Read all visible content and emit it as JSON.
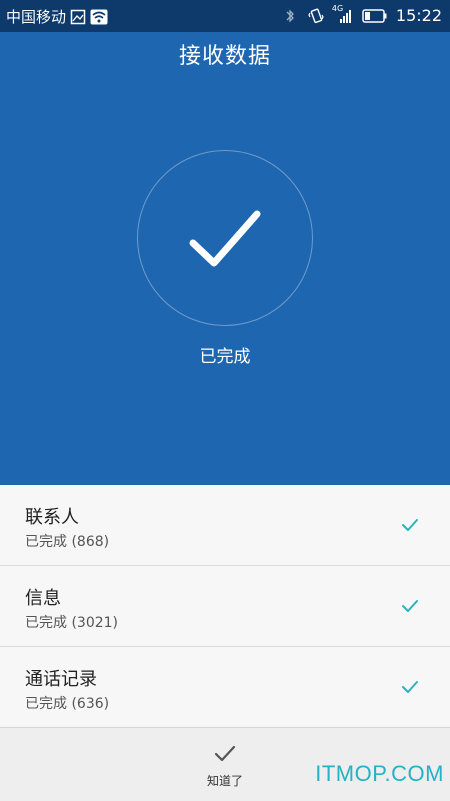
{
  "statusbar": {
    "carrier": "中国移动",
    "network": "4G",
    "time": "15:22"
  },
  "header": {
    "title": "接收数据"
  },
  "progress": {
    "status": "已完成"
  },
  "items": [
    {
      "name": "联系人",
      "status": "已完成 (868)"
    },
    {
      "name": "信息",
      "status": "已完成 (3021)"
    },
    {
      "name": "通话记录",
      "status": "已完成 (636)"
    }
  ],
  "footer": {
    "confirm_label": "知道了"
  },
  "watermark": "ITMOP.COM",
  "colors": {
    "header_bg": "#1f66b1",
    "accent_check": "#2ab3b9"
  }
}
